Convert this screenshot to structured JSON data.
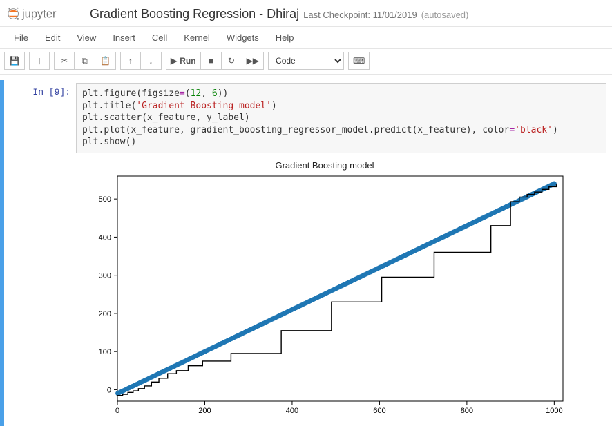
{
  "header": {
    "brand": "jupyter",
    "title": "Gradient Boosting Regression - Dhiraj",
    "checkpoint": "Last Checkpoint: 11/01/2019",
    "autosaved": "(autosaved)"
  },
  "menubar": [
    "File",
    "Edit",
    "View",
    "Insert",
    "Cell",
    "Kernel",
    "Widgets",
    "Help"
  ],
  "toolbar": {
    "run_label": "Run",
    "celltype_selected": "Code"
  },
  "cell": {
    "prompt": "In [9]:",
    "code_lines": [
      {
        "parts": [
          {
            "t": "plt"
          },
          {
            "t": "."
          },
          {
            "t": "figure"
          },
          {
            "t": "(figsize"
          },
          {
            "t": "=",
            "cls": "tok-op"
          },
          {
            "t": "("
          },
          {
            "t": "12",
            "cls": "tok-num"
          },
          {
            "t": ", "
          },
          {
            "t": "6",
            "cls": "tok-num"
          },
          {
            "t": "))"
          }
        ]
      },
      {
        "parts": [
          {
            "t": "plt"
          },
          {
            "t": "."
          },
          {
            "t": "title"
          },
          {
            "t": "("
          },
          {
            "t": "'Gradient Boosting model'",
            "cls": "tok-str"
          },
          {
            "t": ")"
          }
        ]
      },
      {
        "parts": [
          {
            "t": "plt"
          },
          {
            "t": "."
          },
          {
            "t": "scatter"
          },
          {
            "t": "(x_feature, y_label)"
          }
        ]
      },
      {
        "parts": [
          {
            "t": "plt"
          },
          {
            "t": "."
          },
          {
            "t": "plot"
          },
          {
            "t": "(x_feature, gradient_boosting_regressor_model"
          },
          {
            "t": "."
          },
          {
            "t": "predict"
          },
          {
            "t": "(x_feature), color"
          },
          {
            "t": "=",
            "cls": "tok-op"
          },
          {
            "t": "'black'",
            "cls": "tok-str"
          },
          {
            "t": ")"
          }
        ]
      },
      {
        "parts": [
          {
            "t": "plt"
          },
          {
            "t": "."
          },
          {
            "t": "show"
          },
          {
            "t": "()"
          }
        ]
      }
    ]
  },
  "chart_data": {
    "type": "scatter+line",
    "title": "Gradient Boosting model",
    "xlabel": "",
    "ylabel": "",
    "xlim": [
      0,
      1020
    ],
    "ylim": [
      -30,
      560
    ],
    "xticks": [
      0,
      200,
      400,
      600,
      800,
      1000
    ],
    "yticks": [
      0,
      100,
      200,
      300,
      400,
      500
    ],
    "scatter": {
      "color": "#1f77b4",
      "x_range": [
        1,
        1000
      ],
      "slope": 0.55,
      "intercept": -10,
      "n": 300,
      "note": "dense blue points forming a near-linear diagonal band"
    },
    "step_line": {
      "color": "#000000",
      "segments_y": [
        -15,
        -12,
        -7,
        -3,
        3,
        10,
        20,
        30,
        42,
        50,
        63,
        75,
        95,
        155,
        230,
        295,
        360,
        430,
        493,
        505,
        512,
        518,
        525,
        532,
        538
      ],
      "segments_x_breaks": [
        0,
        12,
        24,
        36,
        48,
        62,
        78,
        95,
        115,
        135,
        162,
        195,
        260,
        375,
        490,
        605,
        725,
        855,
        900,
        920,
        938,
        955,
        972,
        988,
        1005
      ]
    }
  }
}
